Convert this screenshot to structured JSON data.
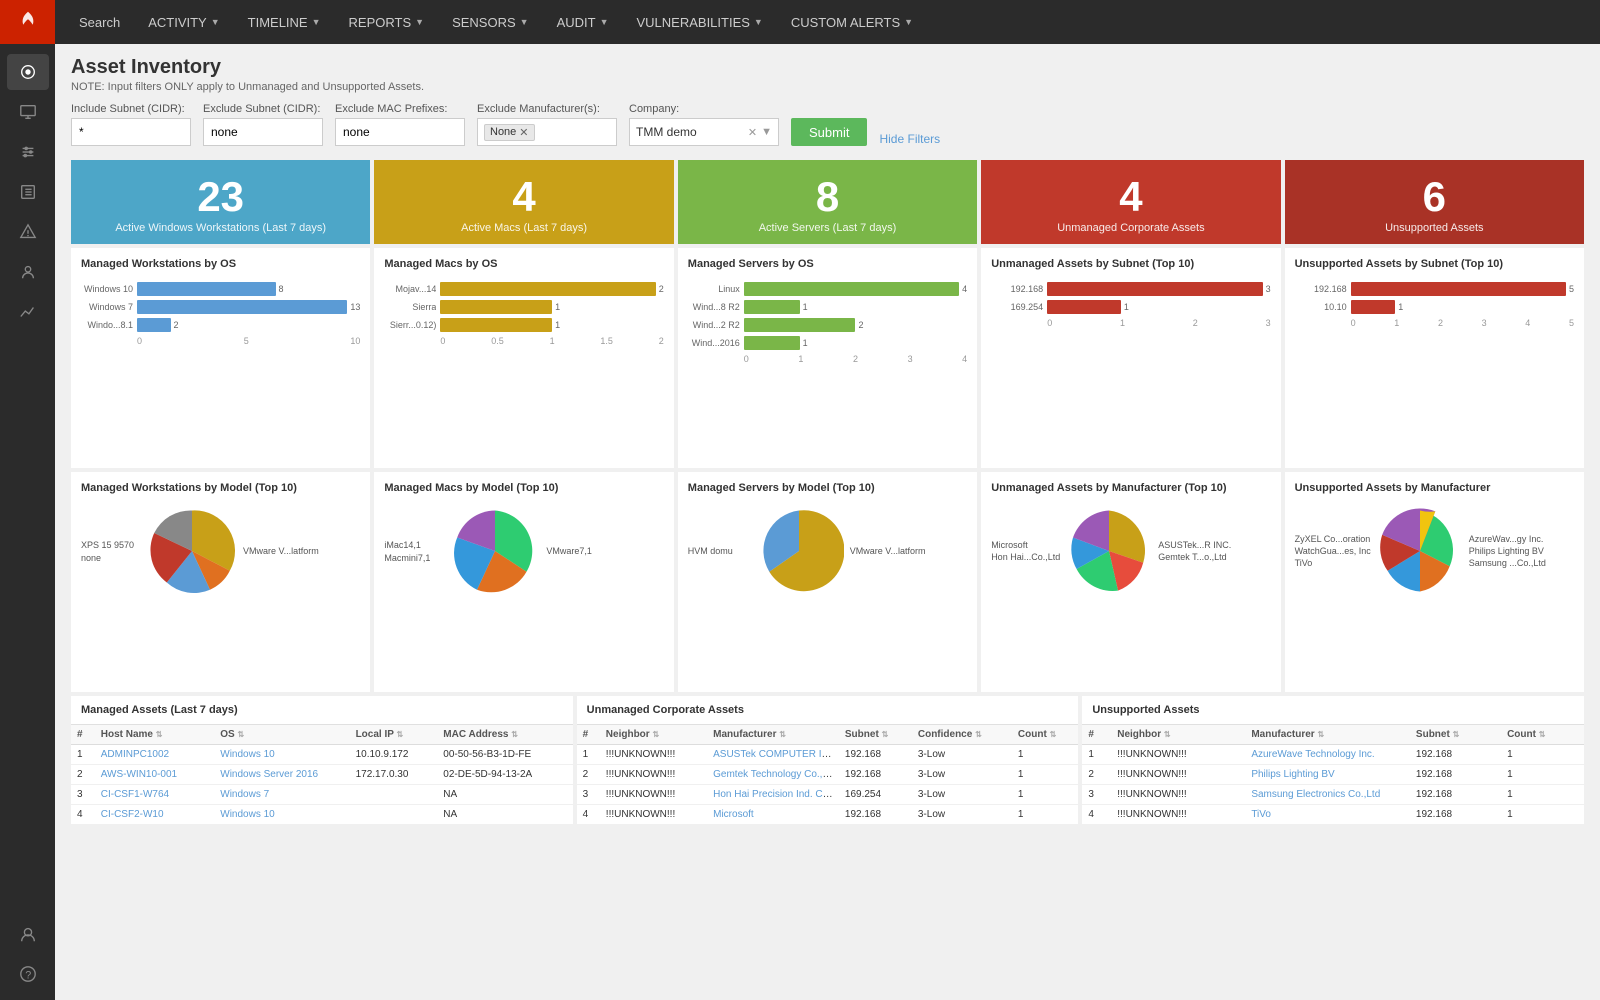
{
  "app": {
    "logo_label": "Forescout"
  },
  "nav": {
    "items": [
      {
        "label": "Search",
        "has_dropdown": false
      },
      {
        "label": "ACTIVITY",
        "has_dropdown": true
      },
      {
        "label": "TIMELINE",
        "has_dropdown": true
      },
      {
        "label": "REPORTS",
        "has_dropdown": true
      },
      {
        "label": "SENSORS",
        "has_dropdown": true
      },
      {
        "label": "AUDIT",
        "has_dropdown": true
      },
      {
        "label": "VULNERABILITIES",
        "has_dropdown": true
      },
      {
        "label": "CUSTOM ALERTS",
        "has_dropdown": true
      }
    ]
  },
  "sidebar": {
    "items": [
      {
        "icon": "wifi-icon",
        "label": "Network"
      },
      {
        "icon": "monitor-icon",
        "label": "Monitor"
      },
      {
        "icon": "sliders-icon",
        "label": "Settings"
      },
      {
        "icon": "list-icon",
        "label": "Inventory"
      },
      {
        "icon": "alert-icon",
        "label": "Alerts"
      },
      {
        "icon": "users-icon",
        "label": "Users"
      },
      {
        "icon": "analytics-icon",
        "label": "Analytics"
      },
      {
        "icon": "user-icon",
        "label": "Profile"
      },
      {
        "icon": "help-icon",
        "label": "Help"
      }
    ]
  },
  "page": {
    "title": "Asset Inventory",
    "note": "NOTE: Input filters ONLY apply to Unmanaged and Unsupported Assets."
  },
  "filters": {
    "include_subnet_label": "Include Subnet (CIDR):",
    "include_subnet_value": "*",
    "exclude_subnet_label": "Exclude Subnet (CIDR):",
    "exclude_subnet_value": "none",
    "exclude_mac_label": "Exclude MAC Prefixes:",
    "exclude_mac_value": "none",
    "exclude_mfr_label": "Exclude Manufacturer(s):",
    "exclude_mfr_tag": "None",
    "company_label": "Company:",
    "company_value": "TMM demo",
    "submit_label": "Submit",
    "hide_filters_label": "Hide Filters"
  },
  "stats": [
    {
      "number": "23",
      "label": "Active Windows Workstations (Last 7 days)",
      "color": "blue"
    },
    {
      "number": "4",
      "label": "Active Macs (Last 7 days)",
      "color": "yellow"
    },
    {
      "number": "8",
      "label": "Active Servers (Last 7 days)",
      "color": "green"
    },
    {
      "number": "4",
      "label": "Unmanaged Corporate Assets",
      "color": "red-dark"
    },
    {
      "number": "6",
      "label": "Unsupported Assets",
      "color": "dark-red"
    }
  ],
  "charts_row1": [
    {
      "title": "Managed Workstations by OS",
      "type": "bar",
      "color": "teal",
      "bars": [
        {
          "label": "Windows 10",
          "value": 8,
          "max": 13
        },
        {
          "label": "Windows 7",
          "value": 13,
          "max": 13
        },
        {
          "label": "Windo...8.1",
          "value": 2,
          "max": 13
        }
      ],
      "axis": [
        "0",
        "5",
        "10"
      ]
    },
    {
      "title": "Managed Macs by OS",
      "type": "bar",
      "color": "yellow",
      "bars": [
        {
          "label": "Mojav...14",
          "value": 2,
          "max": 2
        },
        {
          "label": "Sierra",
          "value": 1,
          "max": 2
        },
        {
          "label": "Sierr...0.12)",
          "value": 1,
          "max": 2
        }
      ],
      "axis": [
        "0",
        "0.5",
        "1",
        "1.5",
        "2"
      ]
    },
    {
      "title": "Managed Servers by OS",
      "type": "bar",
      "color": "green",
      "bars": [
        {
          "label": "Linux",
          "value": 4,
          "max": 4
        },
        {
          "label": "Wind...8 R2",
          "value": 1,
          "max": 4
        },
        {
          "label": "Wind...2 R2",
          "value": 2,
          "max": 4
        },
        {
          "label": "Wind...2016",
          "value": 1,
          "max": 4
        }
      ],
      "axis": [
        "0",
        "1",
        "2",
        "3",
        "4"
      ]
    },
    {
      "title": "Unmanaged Assets by Subnet (Top 10)",
      "type": "bar",
      "color": "red",
      "bars": [
        {
          "label": "192.168",
          "value": 3,
          "max": 3
        },
        {
          "label": "169.254",
          "value": 1,
          "max": 3
        }
      ],
      "axis": [
        "0",
        "1",
        "2",
        "3"
      ]
    },
    {
      "title": "Unsupported Assets by Subnet (Top 10)",
      "type": "bar",
      "color": "red",
      "bars": [
        {
          "label": "192.168",
          "value": 5,
          "max": 5
        },
        {
          "label": "10.10",
          "value": 1,
          "max": 5
        }
      ],
      "axis": [
        "0",
        "1",
        "2",
        "3",
        "4",
        "5"
      ]
    }
  ],
  "charts_row2": [
    {
      "title": "Managed Workstations by Model (Top 10)",
      "type": "pie",
      "legend_left": [
        "XPS 15 9570",
        "none"
      ],
      "legend_right": [
        "VMware V...latform"
      ],
      "slices": [
        {
          "color": "#c8a018",
          "pct": 55
        },
        {
          "color": "#e07020",
          "pct": 12
        },
        {
          "color": "#5b9bd5",
          "pct": 15
        },
        {
          "color": "#c0392b",
          "pct": 10
        },
        {
          "color": "#888",
          "pct": 8
        }
      ]
    },
    {
      "title": "Managed Macs by Model (Top 10)",
      "type": "pie",
      "legend_left": [
        "iMac14,1",
        "Macmini7,1"
      ],
      "legend_right": [
        "VMware7,1"
      ],
      "slices": [
        {
          "color": "#2ecc71",
          "pct": 40
        },
        {
          "color": "#e07020",
          "pct": 25
        },
        {
          "color": "#3498db",
          "pct": 20
        },
        {
          "color": "#9b59b6",
          "pct": 15
        }
      ]
    },
    {
      "title": "Managed Servers by Model (Top 10)",
      "type": "pie",
      "legend_left": [
        "HVM domu"
      ],
      "legend_right": [
        "VMware V...latform"
      ],
      "slices": [
        {
          "color": "#c8a018",
          "pct": 75
        },
        {
          "color": "#5b9bd5",
          "pct": 25
        }
      ]
    },
    {
      "title": "Unmanaged Assets by Manufacturer (Top 10)",
      "type": "pie",
      "legend_left": [
        "Microsoft",
        "Hon Hai...Co.,Ltd"
      ],
      "legend_right": [
        "ASUSTek...R INC.",
        "Gemtek T...o.,Ltd"
      ],
      "slices": [
        {
          "color": "#c8a018",
          "pct": 28
        },
        {
          "color": "#e74c3c",
          "pct": 22
        },
        {
          "color": "#2ecc71",
          "pct": 20
        },
        {
          "color": "#3498db",
          "pct": 18
        },
        {
          "color": "#9b59b6",
          "pct": 12
        }
      ]
    },
    {
      "title": "Unsupported Assets by Manufacturer",
      "type": "pie",
      "legend_left": [
        "ZyXEL Co...oration",
        "WatchGua...es, Inc",
        "TiVo"
      ],
      "legend_right": [
        "AzureWav...gy Inc.",
        "Philips Lighting BV",
        "Samsung ...Co.,Ltd"
      ],
      "slices": [
        {
          "color": "#2ecc71",
          "pct": 22
        },
        {
          "color": "#e07020",
          "pct": 18
        },
        {
          "color": "#3498db",
          "pct": 16
        },
        {
          "color": "#c0392b",
          "pct": 14
        },
        {
          "color": "#9b59b6",
          "pct": 16
        },
        {
          "color": "#f1c40f",
          "pct": 14
        }
      ]
    }
  ],
  "tables": [
    {
      "title": "Managed Assets (Last 7 days)",
      "columns": [
        "#",
        "Host Name",
        "OS",
        "Local IP",
        "MAC Address"
      ],
      "rows": [
        {
          "num": "1",
          "host": "ADMINPC1002",
          "os": "Windows 10",
          "ip": "10.10.9.172",
          "mac": "00-50-56-B3-1D-FE"
        },
        {
          "num": "2",
          "host": "AWS-WIN10-001",
          "os": "Windows Server 2016",
          "ip": "172.17.0.30",
          "mac": "02-DE-5D-94-13-2A"
        },
        {
          "num": "3",
          "host": "CI-CSF1-W764",
          "os": "Windows 7",
          "ip": "",
          "mac": "NA"
        },
        {
          "num": "4",
          "host": "CI-CSF2-W10",
          "os": "Windows 10",
          "ip": "",
          "mac": "NA"
        }
      ]
    },
    {
      "title": "Unmanaged Corporate Assets",
      "columns": [
        "#",
        "Neighbor",
        "Manufacturer",
        "Subnet",
        "Confidence",
        "Count"
      ],
      "rows": [
        {
          "num": "1",
          "neighbor": "!!!UNKNOWN!!!",
          "mfr": "ASUSTek COMPUTER INC",
          "subnet": "192.168",
          "conf": "3-Low",
          "count": "1"
        },
        {
          "num": "2",
          "neighbor": "!!!UNKNOWN!!!",
          "mfr": "Gemtek Technology Co., Ltd.",
          "subnet": "192.168",
          "conf": "3-Low",
          "count": "1"
        },
        {
          "num": "3",
          "neighbor": "!!!UNKNOWN!!!",
          "mfr": "Hon Hai Precision Ind. Co.,Ltd",
          "subnet": "169.254",
          "conf": "3-Low",
          "count": "1"
        },
        {
          "num": "4",
          "neighbor": "!!!UNKNOWN!!!",
          "mfr": "Microsoft",
          "subnet": "192.168",
          "conf": "3-Low",
          "count": "1"
        }
      ]
    },
    {
      "title": "Unsupported Assets",
      "columns": [
        "#",
        "Neighbor",
        "Manufacturer",
        "Subnet",
        "Count"
      ],
      "rows": [
        {
          "num": "1",
          "neighbor": "!!!UNKNOWN!!!",
          "mfr": "AzureWave Technology Inc.",
          "subnet": "192.168",
          "count": "1"
        },
        {
          "num": "2",
          "neighbor": "!!!UNKNOWN!!!",
          "mfr": "Philips Lighting BV",
          "subnet": "192.168",
          "count": "1"
        },
        {
          "num": "3",
          "neighbor": "!!!UNKNOWN!!!",
          "mfr": "Samsung Electronics Co.,Ltd",
          "subnet": "192.168",
          "count": "1"
        },
        {
          "num": "4",
          "neighbor": "!!!UNKNOWN!!!",
          "mfr": "TiVo",
          "subnet": "192.168",
          "count": "1"
        }
      ]
    }
  ]
}
